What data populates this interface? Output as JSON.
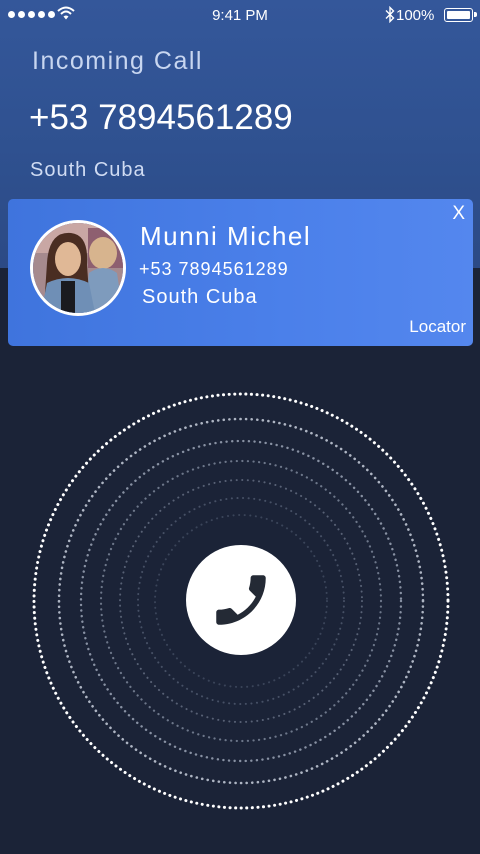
{
  "status_bar": {
    "time": "9:41 PM",
    "battery": "100%",
    "icons": [
      "signal-dots-icon",
      "wifi-icon",
      "bluetooth-icon",
      "battery-icon"
    ]
  },
  "call": {
    "title": "Incoming Call",
    "number": "+53 7894561289",
    "location": "South Cuba"
  },
  "caller_card": {
    "close": "X",
    "name": "Munni Michel",
    "number": "+53 7894561289",
    "location": "South Cuba",
    "badge": "Locator"
  },
  "answer": {
    "icon": "phone-icon"
  },
  "colors": {
    "top_background": "#2f5190",
    "card": "#4a7ee8",
    "bottom_background": "#1b2337"
  }
}
